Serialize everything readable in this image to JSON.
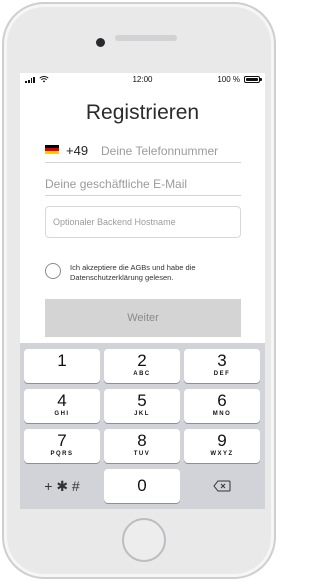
{
  "status_bar": {
    "time": "12:00",
    "battery_percent": "100 %",
    "battery_level": 1.0,
    "icons": [
      "signal-icon",
      "wifi-icon",
      "battery-icon"
    ]
  },
  "form": {
    "title": "Registrieren",
    "country_flag": "germany-flag-icon",
    "country_code": "+49",
    "phone_placeholder": "Deine Telefonnummer",
    "email_placeholder": "Deine geschäftliche E-Mail",
    "backend_placeholder": "Optionaler Backend Hostname",
    "consent_text": "Ich akzeptiere die AGBs und habe die Datenschutzerklärung gelesen.",
    "consent_checked": false,
    "next_label": "Weiter"
  },
  "keypad": {
    "keys": [
      {
        "digit": "1",
        "letters": ""
      },
      {
        "digit": "2",
        "letters": "ABC"
      },
      {
        "digit": "3",
        "letters": "DEF"
      },
      {
        "digit": "4",
        "letters": "GHI"
      },
      {
        "digit": "5",
        "letters": "JKL"
      },
      {
        "digit": "6",
        "letters": "MNO"
      },
      {
        "digit": "7",
        "letters": "PQRS"
      },
      {
        "digit": "8",
        "letters": "TUV"
      },
      {
        "digit": "9",
        "letters": "WXYZ"
      },
      {
        "digit": "0",
        "letters": ""
      }
    ],
    "symbols_label": "+ ✱ #",
    "delete_icon": "backspace-icon"
  },
  "colors": {
    "button_disabled": "#d4d4d4",
    "keypad_background": "#d1d3d9",
    "flag_black": "#000000",
    "flag_red": "#dd0000",
    "flag_gold": "#ffce00"
  }
}
